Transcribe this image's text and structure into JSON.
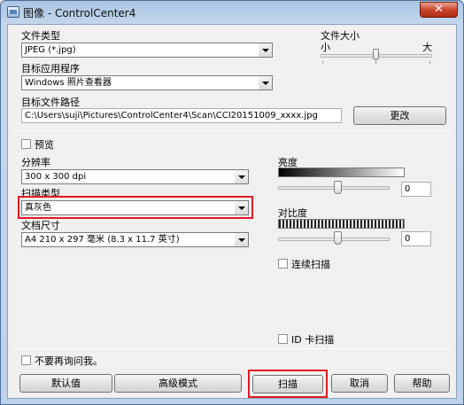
{
  "window": {
    "title": "图像 - ControlCenter4",
    "close_label": "✕"
  },
  "file_type": {
    "label": "文件类型",
    "value": "JPEG (*.jpg)"
  },
  "file_size": {
    "label": "文件大小",
    "min_label": "小",
    "max_label": "大",
    "level": 0.5
  },
  "target_app": {
    "label": "目标应用程序",
    "value": "Windows 照片查看器"
  },
  "target_path": {
    "label": "目标文件路径",
    "value": "C:\\Users\\suji\\Pictures\\ControlCenter4\\Scan\\CCI20151009_xxxx.jpg",
    "change_label": "更改"
  },
  "preview": {
    "label": "预览",
    "checked": false
  },
  "resolution": {
    "label": "分辨率",
    "value": "300 x 300 dpi"
  },
  "scan_type": {
    "label": "扫描类型",
    "value": "真灰色"
  },
  "document_size": {
    "label": "文档尺寸",
    "value": "A4 210 x 297 毫米 (8.3 x 11.7 英寸)"
  },
  "brightness": {
    "label": "亮度",
    "value": "0"
  },
  "contrast": {
    "label": "对比度",
    "value": "0"
  },
  "continuous_scan": {
    "label": "连续扫描",
    "checked": false
  },
  "id_card_scan": {
    "label": "ID 卡扫描",
    "checked": false
  },
  "dont_ask": {
    "label": "不要再询问我。",
    "checked": false
  },
  "buttons": {
    "default_label": "默认值",
    "advanced_label": "高级模式",
    "scan_label": "扫描",
    "cancel_label": "取消",
    "help_label": "帮助"
  },
  "colors": {
    "highlight": "#e01b22"
  }
}
